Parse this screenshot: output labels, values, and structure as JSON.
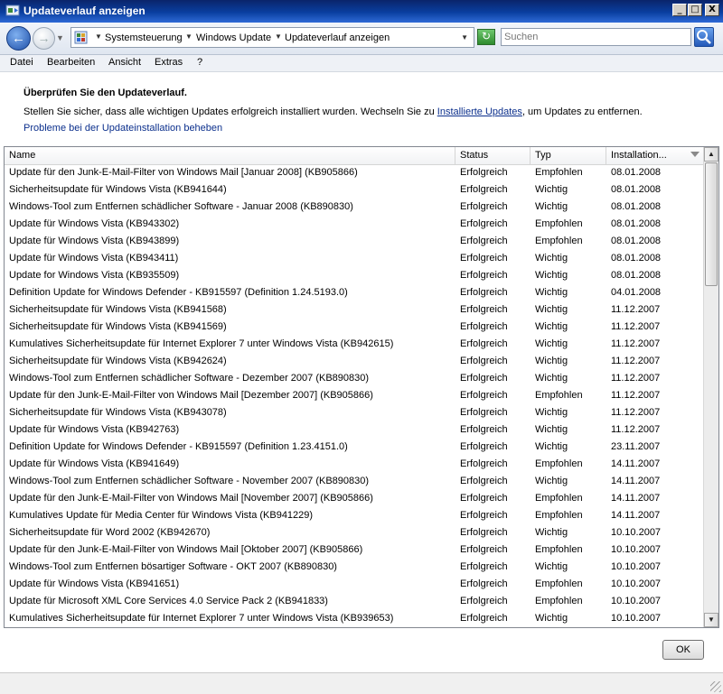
{
  "window": {
    "title": "Updateverlauf anzeigen",
    "controls": {
      "minimize": "_",
      "maximize": "□",
      "close": "X"
    }
  },
  "address": {
    "breadcrumb": [
      "Systemsteuerung",
      "Windows Update",
      "Updateverlauf anzeigen"
    ],
    "search_placeholder": "Suchen"
  },
  "menu": [
    "Datei",
    "Bearbeiten",
    "Ansicht",
    "Extras",
    "?"
  ],
  "page": {
    "heading": "Überprüfen Sie den Updateverlauf.",
    "description_before": "Stellen Sie sicher, dass alle wichtigen Updates erfolgreich installiert wurden. Wechseln Sie zu ",
    "description_link": "Installierte Updates",
    "description_after": ", um Updates zu entfernen.",
    "troubleshoot_link": "Probleme bei der Updateinstallation beheben"
  },
  "list": {
    "columns": [
      "Name",
      "Status",
      "Typ",
      "Installation..."
    ],
    "rows": [
      [
        "Update für den Junk-E-Mail-Filter von Windows Mail [Januar 2008] (KB905866)",
        "Erfolgreich",
        "Empfohlen",
        "08.01.2008"
      ],
      [
        "Sicherheitsupdate für Windows Vista (KB941644)",
        "Erfolgreich",
        "Wichtig",
        "08.01.2008"
      ],
      [
        "Windows-Tool zum Entfernen schädlicher Software - Januar 2008 (KB890830)",
        "Erfolgreich",
        "Wichtig",
        "08.01.2008"
      ],
      [
        "Update für Windows Vista (KB943302)",
        "Erfolgreich",
        "Empfohlen",
        "08.01.2008"
      ],
      [
        "Update für Windows Vista (KB943899)",
        "Erfolgreich",
        "Empfohlen",
        "08.01.2008"
      ],
      [
        "Update für Windows Vista (KB943411)",
        "Erfolgreich",
        "Wichtig",
        "08.01.2008"
      ],
      [
        "Update for Windows Vista (KB935509)",
        "Erfolgreich",
        "Wichtig",
        "08.01.2008"
      ],
      [
        "Definition Update for Windows Defender - KB915597 (Definition 1.24.5193.0)",
        "Erfolgreich",
        "Wichtig",
        "04.01.2008"
      ],
      [
        "Sicherheitsupdate für Windows Vista (KB941568)",
        "Erfolgreich",
        "Wichtig",
        "11.12.2007"
      ],
      [
        "Sicherheitsupdate für Windows Vista (KB941569)",
        "Erfolgreich",
        "Wichtig",
        "11.12.2007"
      ],
      [
        "Kumulatives Sicherheitsupdate für Internet Explorer 7 unter Windows Vista (KB942615)",
        "Erfolgreich",
        "Wichtig",
        "11.12.2007"
      ],
      [
        "Sicherheitsupdate für Windows Vista (KB942624)",
        "Erfolgreich",
        "Wichtig",
        "11.12.2007"
      ],
      [
        "Windows-Tool zum Entfernen schädlicher Software - Dezember 2007 (KB890830)",
        "Erfolgreich",
        "Wichtig",
        "11.12.2007"
      ],
      [
        "Update für den Junk-E-Mail-Filter von Windows Mail [Dezember 2007] (KB905866)",
        "Erfolgreich",
        "Empfohlen",
        "11.12.2007"
      ],
      [
        "Sicherheitsupdate für Windows Vista (KB943078)",
        "Erfolgreich",
        "Wichtig",
        "11.12.2007"
      ],
      [
        "Update für Windows Vista (KB942763)",
        "Erfolgreich",
        "Wichtig",
        "11.12.2007"
      ],
      [
        "Definition Update for Windows Defender - KB915597 (Definition 1.23.4151.0)",
        "Erfolgreich",
        "Wichtig",
        "23.11.2007"
      ],
      [
        "Update für Windows Vista (KB941649)",
        "Erfolgreich",
        "Empfohlen",
        "14.11.2007"
      ],
      [
        "Windows-Tool zum Entfernen schädlicher Software - November 2007 (KB890830)",
        "Erfolgreich",
        "Wichtig",
        "14.11.2007"
      ],
      [
        "Update für den Junk-E-Mail-Filter von Windows Mail [November 2007] (KB905866)",
        "Erfolgreich",
        "Empfohlen",
        "14.11.2007"
      ],
      [
        "Kumulatives Update für Media Center für Windows Vista (KB941229)",
        "Erfolgreich",
        "Empfohlen",
        "14.11.2007"
      ],
      [
        "Sicherheitsupdate für Word 2002 (KB942670)",
        "Erfolgreich",
        "Wichtig",
        "10.10.2007"
      ],
      [
        "Update für den Junk-E-Mail-Filter von Windows Mail [Oktober 2007] (KB905866)",
        "Erfolgreich",
        "Empfohlen",
        "10.10.2007"
      ],
      [
        "Windows-Tool zum Entfernen bösartiger Software - OKT 2007 (KB890830)",
        "Erfolgreich",
        "Wichtig",
        "10.10.2007"
      ],
      [
        "Update für Windows Vista (KB941651)",
        "Erfolgreich",
        "Empfohlen",
        "10.10.2007"
      ],
      [
        "Update für Microsoft XML Core Services 4.0 Service Pack 2 (KB941833)",
        "Erfolgreich",
        "Empfohlen",
        "10.10.2007"
      ],
      [
        "Kumulatives Sicherheitsupdate für Internet Explorer 7 unter Windows Vista (KB939653)",
        "Erfolgreich",
        "Wichtig",
        "10.10.2007"
      ]
    ]
  },
  "footer": {
    "ok_label": "OK"
  },
  "colors": {
    "titlebar": "#0a3fa0",
    "link": "#0b2f8c",
    "list_border": "#828790"
  },
  "icons": [
    "back-arrow-icon",
    "forward-arrow-icon",
    "control-panel-icon",
    "refresh-icon",
    "search-icon",
    "sort-descending-icon",
    "resize-grip-icon"
  ]
}
